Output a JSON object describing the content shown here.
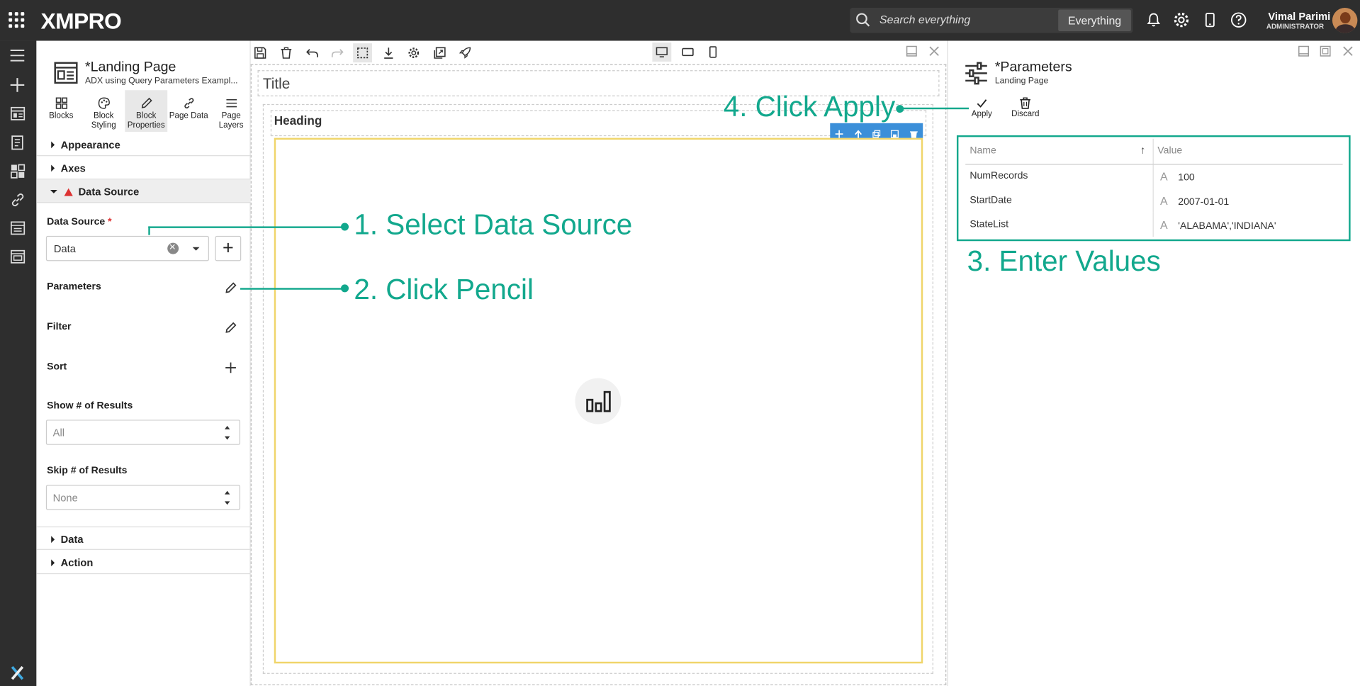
{
  "topbar": {
    "logo": "XMPRO",
    "search_placeholder": "Search everything",
    "scope_button": "Everything",
    "user_name": "Vimal Parimi",
    "user_role": "ADMINISTRATOR"
  },
  "props": {
    "title": "*Landing Page",
    "subtitle": "ADX using Query Parameters Exampl...",
    "tabs": [
      {
        "label": "Blocks",
        "icon": "blocks-icon"
      },
      {
        "label": "Block Styling",
        "icon": "palette-icon"
      },
      {
        "label": "Block Properties",
        "icon": "pencil-icon"
      },
      {
        "label": "Page Data",
        "icon": "link-icon"
      },
      {
        "label": "Page Layers",
        "icon": "layers-icon"
      }
    ],
    "sections": {
      "appearance": "Appearance",
      "axes": "Axes",
      "data_source": "Data Source",
      "data": "Data",
      "action": "Action"
    },
    "data_source_label": "Data Source",
    "data_source_required": "*",
    "data_source_value": "Data",
    "parameters_label": "Parameters",
    "filter_label": "Filter",
    "sort_label": "Sort",
    "show_results_label": "Show # of Results",
    "show_results_placeholder": "All",
    "skip_results_label": "Skip # of Results",
    "skip_results_placeholder": "None"
  },
  "canvas": {
    "title": "Title",
    "heading": "Heading"
  },
  "right": {
    "title": "*Parameters",
    "subtitle": "Landing Page",
    "apply_label": "Apply",
    "discard_label": "Discard",
    "columns": [
      "Name",
      "Value"
    ],
    "rows": [
      {
        "name": "NumRecords",
        "value": "100"
      },
      {
        "name": "StartDate",
        "value": "2007-01-01"
      },
      {
        "name": "StateList",
        "value": "'ALABAMA','INDIANA'"
      }
    ]
  },
  "callouts": {
    "step1": "1. Select Data Source",
    "step2": "2. Click Pencil",
    "step3": "3. Enter Values",
    "step4": "4. Click Apply"
  },
  "colors": {
    "accent": "#12a88d",
    "topbar": "#2e2e2e",
    "block_border": "#f0d56a",
    "block_tools": "#3b8fd9"
  }
}
